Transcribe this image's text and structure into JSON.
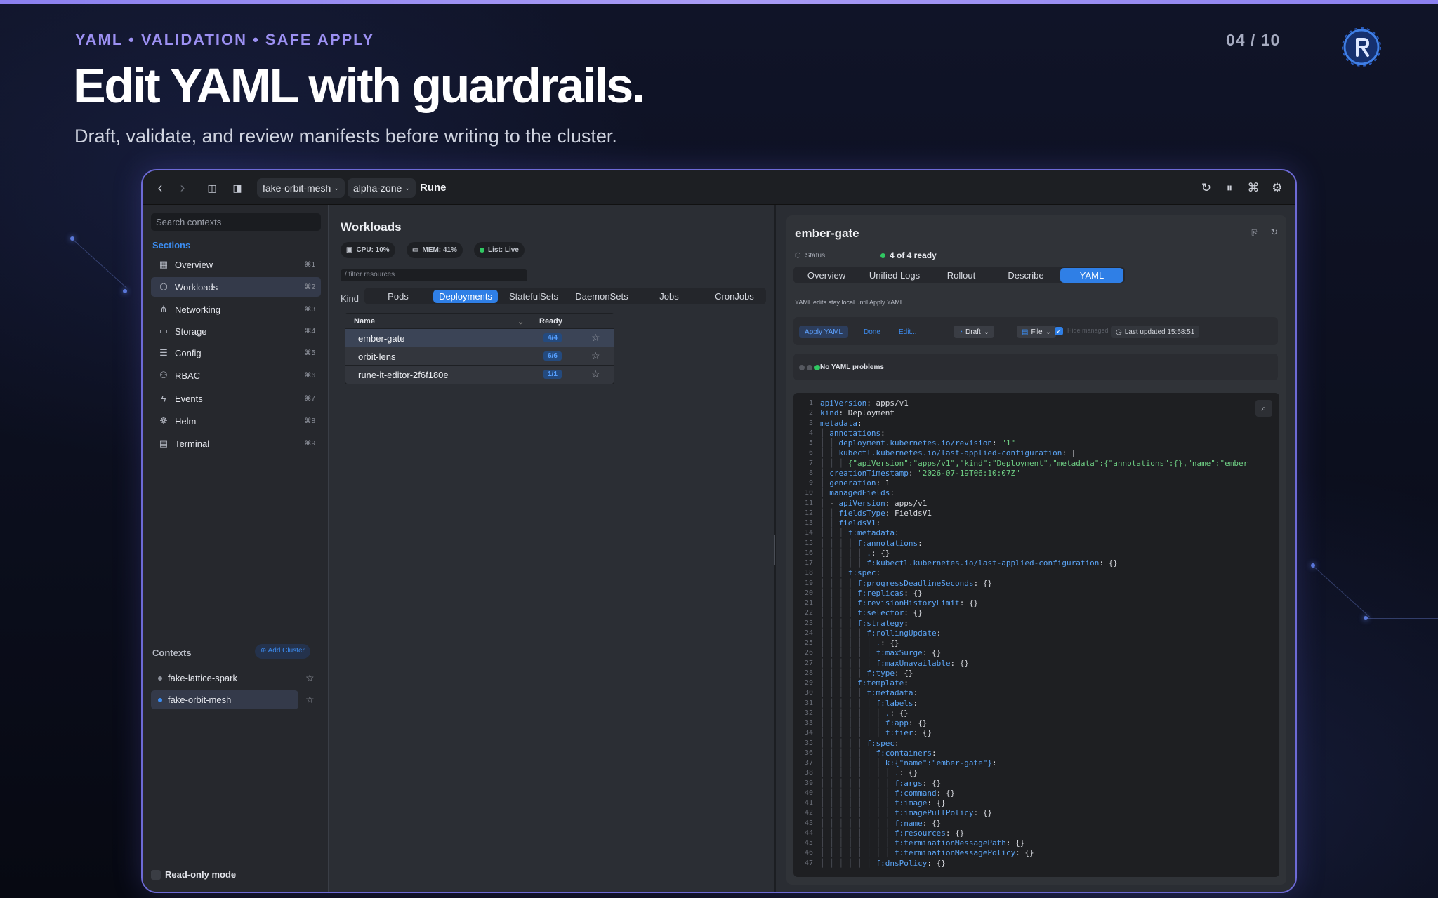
{
  "slide": {
    "eyebrow": "YAML • VALIDATION • SAFE APPLY",
    "counter": "04 / 10",
    "headline": "Edit YAML with guardrails.",
    "subtitle": "Draft, validate, and review manifests before writing to the cluster."
  },
  "titlebar": {
    "cluster": "fake-orbit-mesh",
    "namespace": "alpha-zone",
    "app": "Rune"
  },
  "sidebar": {
    "search_placeholder": "Search contexts",
    "sections_label": "Sections",
    "items": [
      {
        "label": "Overview",
        "shortcut": "⌘1",
        "icon": "grid-icon"
      },
      {
        "label": "Workloads",
        "shortcut": "⌘2",
        "icon": "cube-icon"
      },
      {
        "label": "Networking",
        "shortcut": "⌘3",
        "icon": "network-icon"
      },
      {
        "label": "Storage",
        "shortcut": "⌘4",
        "icon": "disk-icon"
      },
      {
        "label": "Config",
        "shortcut": "⌘5",
        "icon": "sliders-icon"
      },
      {
        "label": "RBAC",
        "shortcut": "⌘6",
        "icon": "users-icon"
      },
      {
        "label": "Events",
        "shortcut": "⌘7",
        "icon": "bolt-icon"
      },
      {
        "label": "Helm",
        "shortcut": "⌘8",
        "icon": "helm-icon"
      },
      {
        "label": "Terminal",
        "shortcut": "⌘9",
        "icon": "terminal-icon"
      }
    ],
    "contexts_label": "Contexts",
    "add_cluster": "Add Cluster",
    "contexts": [
      {
        "name": "fake-lattice-spark"
      },
      {
        "name": "fake-orbit-mesh"
      }
    ],
    "read_only": "Read-only mode"
  },
  "workloads": {
    "title": "Workloads",
    "chips": {
      "cpu": "CPU: 10%",
      "mem": "MEM: 41%",
      "list": "List: Live"
    },
    "filter_placeholder": "/ filter resources",
    "kind_label": "Kind",
    "kinds": [
      "Pods",
      "Deployments",
      "StatefulSets",
      "DaemonSets",
      "Jobs",
      "CronJobs"
    ],
    "active_kind": "Deployments",
    "columns": {
      "name": "Name",
      "ready": "Ready"
    },
    "rows": [
      {
        "name": "ember-gate",
        "ready": "4/4"
      },
      {
        "name": "orbit-lens",
        "ready": "6/6"
      },
      {
        "name": "rune-it-editor-2f6f180e",
        "ready": "1/1"
      }
    ]
  },
  "detail": {
    "title": "ember-gate",
    "status_label": "Status",
    "status_value": "4 of 4 ready",
    "tabs": [
      "Overview",
      "Unified Logs",
      "Rollout",
      "Describe",
      "YAML"
    ],
    "active_tab": "YAML",
    "hint": "YAML edits stay local until Apply YAML.",
    "toolbar": {
      "apply": "Apply YAML",
      "done": "Done",
      "edit": "Edit...",
      "draft": "Draft",
      "file": "File",
      "hide_managed": "Hide managed",
      "last_updated": "Last updated 15:58:51"
    },
    "problems": "No YAML problems"
  },
  "colors": {
    "accent": "#2f7fe6",
    "brand": "#8b80f0",
    "ok": "#30c862"
  },
  "yaml": [
    {
      "i": 0,
      "k": "apiVersion",
      "v": "apps/v1"
    },
    {
      "i": 0,
      "k": "kind",
      "v": "Deployment"
    },
    {
      "i": 0,
      "k": "metadata",
      "v": ""
    },
    {
      "i": 1,
      "k": "annotations",
      "v": ""
    },
    {
      "i": 2,
      "k": "deployment.kubernetes.io/revision",
      "s": "\"1\""
    },
    {
      "i": 2,
      "k": "kubectl.kubernetes.io/last-applied-configuration",
      "v": "|"
    },
    {
      "i": 3,
      "s": "{\"apiVersion\":\"apps/v1\",\"kind\":\"Deployment\",\"metadata\":{\"annotations\":{},\"name\":\"ember"
    },
    {
      "i": 1,
      "k": "creationTimestamp",
      "s": "\"2026-07-19T06:10:07Z\""
    },
    {
      "i": 1,
      "k": "generation",
      "v": "1"
    },
    {
      "i": 1,
      "k": "managedFields",
      "v": ""
    },
    {
      "i": 1,
      "p": "- ",
      "k": "apiVersion",
      "v": "apps/v1"
    },
    {
      "i": 2,
      "k": "fieldsType",
      "v": "FieldsV1"
    },
    {
      "i": 2,
      "k": "fieldsV1",
      "v": ""
    },
    {
      "i": 3,
      "k": "f:metadata",
      "v": ""
    },
    {
      "i": 4,
      "k": "f:annotations",
      "v": ""
    },
    {
      "i": 5,
      "k": ".",
      "v": "{}"
    },
    {
      "i": 5,
      "k": "f:kubectl.kubernetes.io/last-applied-configuration",
      "v": "{}"
    },
    {
      "i": 3,
      "k": "f:spec",
      "v": ""
    },
    {
      "i": 4,
      "k": "f:progressDeadlineSeconds",
      "v": "{}"
    },
    {
      "i": 4,
      "k": "f:replicas",
      "v": "{}"
    },
    {
      "i": 4,
      "k": "f:revisionHistoryLimit",
      "v": "{}"
    },
    {
      "i": 4,
      "k": "f:selector",
      "v": "{}"
    },
    {
      "i": 4,
      "k": "f:strategy",
      "v": ""
    },
    {
      "i": 5,
      "k": "f:rollingUpdate",
      "v": ""
    },
    {
      "i": 6,
      "k": ".",
      "v": "{}"
    },
    {
      "i": 6,
      "k": "f:maxSurge",
      "v": "{}"
    },
    {
      "i": 6,
      "k": "f:maxUnavailable",
      "v": "{}"
    },
    {
      "i": 5,
      "k": "f:type",
      "v": "{}"
    },
    {
      "i": 4,
      "k": "f:template",
      "v": ""
    },
    {
      "i": 5,
      "k": "f:metadata",
      "v": ""
    },
    {
      "i": 6,
      "k": "f:labels",
      "v": ""
    },
    {
      "i": 7,
      "k": ".",
      "v": "{}"
    },
    {
      "i": 7,
      "k": "f:app",
      "v": "{}"
    },
    {
      "i": 7,
      "k": "f:tier",
      "v": "{}"
    },
    {
      "i": 5,
      "k": "f:spec",
      "v": ""
    },
    {
      "i": 6,
      "k": "f:containers",
      "v": ""
    },
    {
      "i": 7,
      "k": "k:{\"name\":\"ember-gate\"}",
      "v": ""
    },
    {
      "i": 8,
      "k": ".",
      "v": "{}"
    },
    {
      "i": 8,
      "k": "f:args",
      "v": "{}"
    },
    {
      "i": 8,
      "k": "f:command",
      "v": "{}"
    },
    {
      "i": 8,
      "k": "f:image",
      "v": "{}"
    },
    {
      "i": 8,
      "k": "f:imagePullPolicy",
      "v": "{}"
    },
    {
      "i": 8,
      "k": "f:name",
      "v": "{}"
    },
    {
      "i": 8,
      "k": "f:resources",
      "v": "{}"
    },
    {
      "i": 8,
      "k": "f:terminationMessagePath",
      "v": "{}"
    },
    {
      "i": 8,
      "k": "f:terminationMessagePolicy",
      "v": "{}"
    },
    {
      "i": 6,
      "k": "f:dnsPolicy",
      "v": "{}"
    }
  ]
}
